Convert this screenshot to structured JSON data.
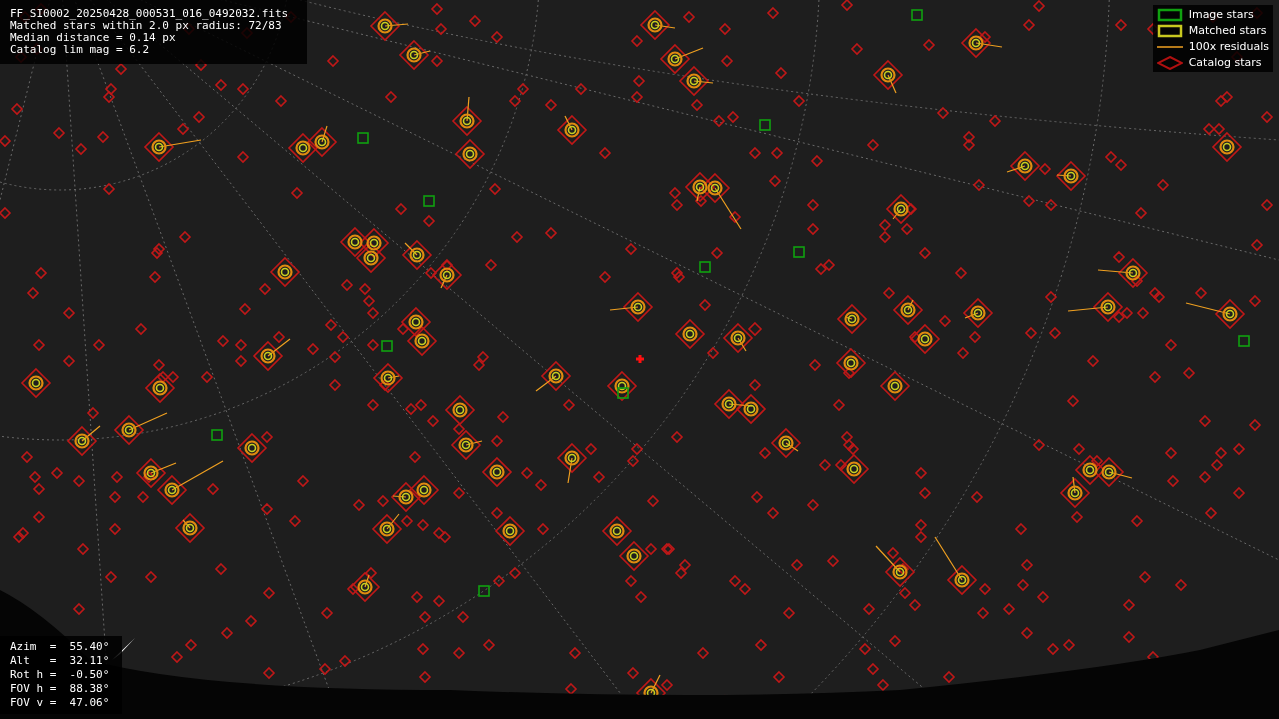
{
  "info_lines": [
    "FF_SI0002_20250428_000531_016_0492032.fits",
    "Matched stars within 2.0 px radius: 72/83",
    "Median distance = 0.14 px",
    "Catalog lim mag = 6.2"
  ],
  "legend": [
    {
      "kind": "image",
      "label": "Image stars"
    },
    {
      "kind": "matched",
      "label": "Matched stars"
    },
    {
      "kind": "residual",
      "label": "100x residuals"
    },
    {
      "kind": "catalog",
      "label": "Catalog stars"
    }
  ],
  "pointing_lines": [
    "Azim  =  55.40°",
    "Alt   =  32.11°",
    "Rot h =  -0.50°",
    "FOV h =  88.38°",
    "FOV v =  47.06°"
  ]
}
